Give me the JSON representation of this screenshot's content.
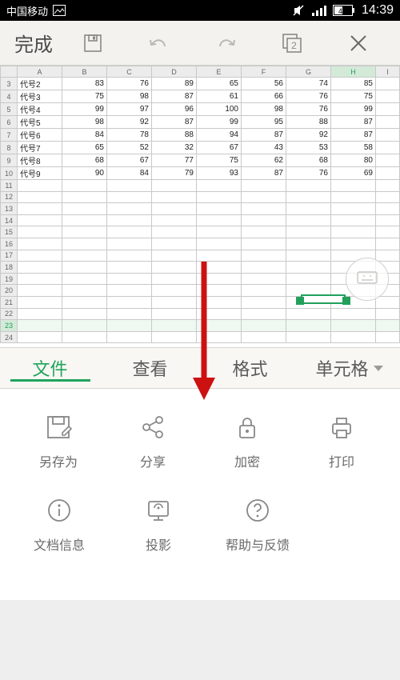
{
  "statusbar": {
    "carrier": "中国移动",
    "battery": "47",
    "time": "14:39"
  },
  "toolbar": {
    "done": "完成",
    "page_badge": "2"
  },
  "sheet": {
    "columns": [
      "",
      "A",
      "B",
      "C",
      "D",
      "E",
      "F",
      "G",
      "H",
      "I"
    ],
    "selected_col": "H",
    "selected_row": 23,
    "rows": [
      {
        "n": 3,
        "a": "代号2",
        "b": "83",
        "c": "76",
        "d": "89",
        "e": "65",
        "f": "56",
        "g": "74",
        "h": "85"
      },
      {
        "n": 4,
        "a": "代号3",
        "b": "75",
        "c": "98",
        "d": "87",
        "e": "61",
        "f": "66",
        "g": "76",
        "h": "75"
      },
      {
        "n": 5,
        "a": "代号4",
        "b": "99",
        "c": "97",
        "d": "96",
        "e": "100",
        "f": "98",
        "g": "76",
        "h": "99"
      },
      {
        "n": 6,
        "a": "代号5",
        "b": "98",
        "c": "92",
        "d": "87",
        "e": "99",
        "f": "95",
        "g": "88",
        "h": "87"
      },
      {
        "n": 7,
        "a": "代号6",
        "b": "84",
        "c": "78",
        "d": "88",
        "e": "94",
        "f": "87",
        "g": "92",
        "h": "87"
      },
      {
        "n": 8,
        "a": "代号7",
        "b": "65",
        "c": "52",
        "d": "32",
        "e": "67",
        "f": "43",
        "g": "53",
        "h": "58"
      },
      {
        "n": 9,
        "a": "代号8",
        "b": "68",
        "c": "67",
        "d": "77",
        "e": "75",
        "f": "62",
        "g": "68",
        "h": "80"
      },
      {
        "n": 10,
        "a": "代号9",
        "b": "90",
        "c": "84",
        "d": "79",
        "e": "93",
        "f": "87",
        "g": "76",
        "h": "69"
      },
      {
        "n": 11
      },
      {
        "n": 12
      },
      {
        "n": 13
      },
      {
        "n": 14
      },
      {
        "n": 15
      },
      {
        "n": 16
      },
      {
        "n": 17
      },
      {
        "n": 18
      },
      {
        "n": 19
      },
      {
        "n": 20
      },
      {
        "n": 21
      },
      {
        "n": 22
      },
      {
        "n": 23
      },
      {
        "n": 24
      }
    ]
  },
  "tabs": {
    "items": [
      "文件",
      "查看",
      "格式",
      "单元格"
    ],
    "active": 0
  },
  "panel": {
    "row1": [
      {
        "label": "另存为"
      },
      {
        "label": "分享"
      },
      {
        "label": "加密"
      },
      {
        "label": "打印"
      }
    ],
    "row2": [
      {
        "label": "文档信息"
      },
      {
        "label": "投影"
      },
      {
        "label": "帮助与反馈"
      }
    ]
  }
}
